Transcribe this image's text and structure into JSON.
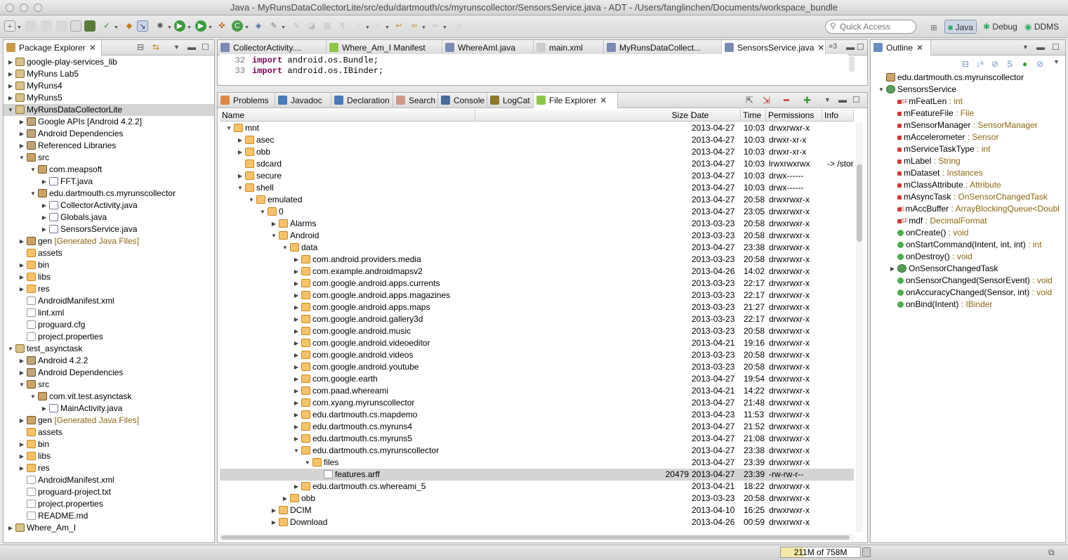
{
  "window": {
    "title": "Java - MyRunsDataCollectorLite/src/edu/dartmouth/cs/myrunscollector/SensorsService.java - ADT - /Users/fanglinchen/Documents/workspace_bundle"
  },
  "toolbar": {
    "quick_access_placeholder": "Quick Access",
    "perspectives": [
      "Java",
      "Debug",
      "DDMS"
    ]
  },
  "package_explorer": {
    "tab_label": "Package Explorer",
    "items": [
      {
        "label": "google-play-services_lib",
        "suffix": "",
        "depth": 0,
        "icon": "proj",
        "twist": "closed"
      },
      {
        "label": "MyRuns Lab5",
        "suffix": "",
        "depth": 0,
        "icon": "proj",
        "twist": "closed"
      },
      {
        "label": "MyRuns4",
        "suffix": "",
        "depth": 0,
        "icon": "proj",
        "twist": "closed"
      },
      {
        "label": "MyRuns5",
        "suffix": "",
        "depth": 0,
        "icon": "proj",
        "twist": "closed"
      },
      {
        "label": "MyRunsDataCollectorLite",
        "suffix": "",
        "depth": 0,
        "icon": "proj",
        "twist": "open",
        "selected": true
      },
      {
        "label": "Google APIs [Android 4.2.2]",
        "suffix": "",
        "depth": 1,
        "icon": "lib",
        "twist": "closed"
      },
      {
        "label": "Android Dependencies",
        "suffix": "",
        "depth": 1,
        "icon": "lib",
        "twist": "closed"
      },
      {
        "label": "Referenced Libraries",
        "suffix": "",
        "depth": 1,
        "icon": "lib",
        "twist": "closed"
      },
      {
        "label": "src",
        "suffix": "",
        "depth": 1,
        "icon": "pkg",
        "twist": "open"
      },
      {
        "label": "com.meapsoft",
        "suffix": "",
        "depth": 2,
        "icon": "pkg",
        "twist": "open"
      },
      {
        "label": "FFT.java",
        "suffix": "",
        "depth": 3,
        "icon": "java",
        "twist": "closed"
      },
      {
        "label": "edu.dartmouth.cs.myrunscollector",
        "suffix": "",
        "depth": 2,
        "icon": "pkg",
        "twist": "open"
      },
      {
        "label": "CollectorActivity.java",
        "suffix": "",
        "depth": 3,
        "icon": "java",
        "twist": "closed"
      },
      {
        "label": "Globals.java",
        "suffix": "",
        "depth": 3,
        "icon": "java",
        "twist": "closed"
      },
      {
        "label": "SensorsService.java",
        "suffix": "",
        "depth": 3,
        "icon": "java",
        "twist": "closed"
      },
      {
        "label": "gen",
        "suffix": " [Generated Java Files]",
        "depth": 1,
        "icon": "pkg",
        "twist": "closed"
      },
      {
        "label": "assets",
        "suffix": "",
        "depth": 1,
        "icon": "folder",
        "twist": "none"
      },
      {
        "label": "bin",
        "suffix": "",
        "depth": 1,
        "icon": "folder",
        "twist": "closed"
      },
      {
        "label": "libs",
        "suffix": "",
        "depth": 1,
        "icon": "folder",
        "twist": "closed"
      },
      {
        "label": "res",
        "suffix": "",
        "depth": 1,
        "icon": "folder",
        "twist": "closed"
      },
      {
        "label": "AndroidManifest.xml",
        "suffix": "",
        "depth": 1,
        "icon": "file",
        "twist": "none"
      },
      {
        "label": "lint.xml",
        "suffix": "",
        "depth": 1,
        "icon": "file",
        "twist": "none"
      },
      {
        "label": "proguard.cfg",
        "suffix": "",
        "depth": 1,
        "icon": "file",
        "twist": "none"
      },
      {
        "label": "project.properties",
        "suffix": "",
        "depth": 1,
        "icon": "file",
        "twist": "none"
      },
      {
        "label": "test_asynctask",
        "suffix": "",
        "depth": 0,
        "icon": "proj",
        "twist": "open"
      },
      {
        "label": "Android 4.2.2",
        "suffix": "",
        "depth": 1,
        "icon": "lib",
        "twist": "closed"
      },
      {
        "label": "Android Dependencies",
        "suffix": "",
        "depth": 1,
        "icon": "lib",
        "twist": "closed"
      },
      {
        "label": "src",
        "suffix": "",
        "depth": 1,
        "icon": "pkg",
        "twist": "open"
      },
      {
        "label": "com.vit.test.asynctask",
        "suffix": "",
        "depth": 2,
        "icon": "pkg",
        "twist": "open"
      },
      {
        "label": "MainActivity.java",
        "suffix": "",
        "depth": 3,
        "icon": "java",
        "twist": "closed"
      },
      {
        "label": "gen",
        "suffix": " [Generated Java Files]",
        "depth": 1,
        "icon": "pkg",
        "twist": "closed"
      },
      {
        "label": "assets",
        "suffix": "",
        "depth": 1,
        "icon": "folder",
        "twist": "none"
      },
      {
        "label": "bin",
        "suffix": "",
        "depth": 1,
        "icon": "folder",
        "twist": "closed"
      },
      {
        "label": "libs",
        "suffix": "",
        "depth": 1,
        "icon": "folder",
        "twist": "closed"
      },
      {
        "label": "res",
        "suffix": "",
        "depth": 1,
        "icon": "folder",
        "twist": "closed"
      },
      {
        "label": "AndroidManifest.xml",
        "suffix": "",
        "depth": 1,
        "icon": "file",
        "twist": "none"
      },
      {
        "label": "proguard-project.txt",
        "suffix": "",
        "depth": 1,
        "icon": "file",
        "twist": "none"
      },
      {
        "label": "project.properties",
        "suffix": "",
        "depth": 1,
        "icon": "file",
        "twist": "none"
      },
      {
        "label": "README.md",
        "suffix": "",
        "depth": 1,
        "icon": "file",
        "twist": "none"
      },
      {
        "label": "Where_Am_I",
        "suffix": "",
        "depth": 0,
        "icon": "proj",
        "twist": "closed"
      }
    ]
  },
  "editor": {
    "tabs": [
      "CollectorActivity....",
      "Where_Am_I Manifest",
      "WhereAmI.java",
      "main.xml",
      "MyRunsDataCollect...",
      "SensorsService.java"
    ],
    "overflow": "»3",
    "lines": [
      {
        "num": "32",
        "kw": "import",
        "text": " android.os.Bundle;"
      },
      {
        "num": "33",
        "kw": "import",
        "text": " android.os.IBinder;"
      }
    ]
  },
  "bottom_tabs": [
    "Problems",
    "Javadoc",
    "Declaration",
    "Search",
    "Console",
    "LogCat",
    "File Explorer"
  ],
  "file_explorer": {
    "columns": [
      "Name",
      "Size",
      "Date",
      "Time",
      "Permissions",
      "Info"
    ],
    "rows": [
      {
        "name": "mnt",
        "depth": 0,
        "twist": "open",
        "size": "",
        "date": "2013-04-27",
        "time": "10:03",
        "perm": "drwxrwxr-x",
        "info": ""
      },
      {
        "name": "asec",
        "depth": 1,
        "twist": "closed",
        "size": "",
        "date": "2013-04-27",
        "time": "10:03",
        "perm": "drwxr-xr-x",
        "info": ""
      },
      {
        "name": "obb",
        "depth": 1,
        "twist": "closed",
        "size": "",
        "date": "2013-04-27",
        "time": "10:03",
        "perm": "drwxr-xr-x",
        "info": ""
      },
      {
        "name": "sdcard",
        "depth": 1,
        "twist": "none",
        "size": "",
        "date": "2013-04-27",
        "time": "10:03",
        "perm": "lrwxrwxrwx",
        "info": "-> /stora"
      },
      {
        "name": "secure",
        "depth": 1,
        "twist": "closed",
        "size": "",
        "date": "2013-04-27",
        "time": "10:03",
        "perm": "drwx------",
        "info": ""
      },
      {
        "name": "shell",
        "depth": 1,
        "twist": "open",
        "size": "",
        "date": "2013-04-27",
        "time": "10:03",
        "perm": "drwx------",
        "info": ""
      },
      {
        "name": "emulated",
        "depth": 2,
        "twist": "open",
        "size": "",
        "date": "2013-04-27",
        "time": "20:58",
        "perm": "drwxrwxr-x",
        "info": ""
      },
      {
        "name": "0",
        "depth": 3,
        "twist": "open",
        "size": "",
        "date": "2013-04-27",
        "time": "23:05",
        "perm": "drwxrwxr-x",
        "info": ""
      },
      {
        "name": "Alarms",
        "depth": 4,
        "twist": "closed",
        "size": "",
        "date": "2013-03-23",
        "time": "20:58",
        "perm": "drwxrwxr-x",
        "info": ""
      },
      {
        "name": "Android",
        "depth": 4,
        "twist": "open",
        "size": "",
        "date": "2013-03-23",
        "time": "20:58",
        "perm": "drwxrwxr-x",
        "info": ""
      },
      {
        "name": "data",
        "depth": 5,
        "twist": "open",
        "size": "",
        "date": "2013-04-27",
        "time": "23:38",
        "perm": "drwxrwxr-x",
        "info": ""
      },
      {
        "name": "com.android.providers.media",
        "depth": 6,
        "twist": "closed",
        "size": "",
        "date": "2013-03-23",
        "time": "20:58",
        "perm": "drwxrwxr-x",
        "info": ""
      },
      {
        "name": "com.example.androidmapsv2",
        "depth": 6,
        "twist": "closed",
        "size": "",
        "date": "2013-04-26",
        "time": "14:02",
        "perm": "drwxrwxr-x",
        "info": ""
      },
      {
        "name": "com.google.android.apps.currents",
        "depth": 6,
        "twist": "closed",
        "size": "",
        "date": "2013-03-23",
        "time": "22:17",
        "perm": "drwxrwxr-x",
        "info": ""
      },
      {
        "name": "com.google.android.apps.magazines",
        "depth": 6,
        "twist": "closed",
        "size": "",
        "date": "2013-03-23",
        "time": "22:17",
        "perm": "drwxrwxr-x",
        "info": ""
      },
      {
        "name": "com.google.android.apps.maps",
        "depth": 6,
        "twist": "closed",
        "size": "",
        "date": "2013-03-23",
        "time": "21:27",
        "perm": "drwxrwxr-x",
        "info": ""
      },
      {
        "name": "com.google.android.gallery3d",
        "depth": 6,
        "twist": "closed",
        "size": "",
        "date": "2013-03-23",
        "time": "22:17",
        "perm": "drwxrwxr-x",
        "info": ""
      },
      {
        "name": "com.google.android.music",
        "depth": 6,
        "twist": "closed",
        "size": "",
        "date": "2013-03-23",
        "time": "20:58",
        "perm": "drwxrwxr-x",
        "info": ""
      },
      {
        "name": "com.google.android.videoeditor",
        "depth": 6,
        "twist": "closed",
        "size": "",
        "date": "2013-04-21",
        "time": "19:16",
        "perm": "drwxrwxr-x",
        "info": ""
      },
      {
        "name": "com.google.android.videos",
        "depth": 6,
        "twist": "closed",
        "size": "",
        "date": "2013-03-23",
        "time": "20:58",
        "perm": "drwxrwxr-x",
        "info": ""
      },
      {
        "name": "com.google.android.youtube",
        "depth": 6,
        "twist": "closed",
        "size": "",
        "date": "2013-03-23",
        "time": "20:58",
        "perm": "drwxrwxr-x",
        "info": ""
      },
      {
        "name": "com.google.earth",
        "depth": 6,
        "twist": "closed",
        "size": "",
        "date": "2013-04-27",
        "time": "19:54",
        "perm": "drwxrwxr-x",
        "info": ""
      },
      {
        "name": "com.paad.whereami",
        "depth": 6,
        "twist": "closed",
        "size": "",
        "date": "2013-04-21",
        "time": "14:22",
        "perm": "drwxrwxr-x",
        "info": ""
      },
      {
        "name": "com.xyang.myrunscollector",
        "depth": 6,
        "twist": "closed",
        "size": "",
        "date": "2013-04-27",
        "time": "21:48",
        "perm": "drwxrwxr-x",
        "info": ""
      },
      {
        "name": "edu.dartmouth.cs.mapdemo",
        "depth": 6,
        "twist": "closed",
        "size": "",
        "date": "2013-04-23",
        "time": "11:53",
        "perm": "drwxrwxr-x",
        "info": ""
      },
      {
        "name": "edu.dartmouth.cs.myruns4",
        "depth": 6,
        "twist": "closed",
        "size": "",
        "date": "2013-04-27",
        "time": "21:52",
        "perm": "drwxrwxr-x",
        "info": ""
      },
      {
        "name": "edu.dartmouth.cs.myruns5",
        "depth": 6,
        "twist": "closed",
        "size": "",
        "date": "2013-04-27",
        "time": "21:08",
        "perm": "drwxrwxr-x",
        "info": ""
      },
      {
        "name": "edu.dartmouth.cs.myrunscollector",
        "depth": 6,
        "twist": "open",
        "size": "",
        "date": "2013-04-27",
        "time": "23:38",
        "perm": "drwxrwxr-x",
        "info": ""
      },
      {
        "name": "files",
        "depth": 7,
        "twist": "open",
        "size": "",
        "date": "2013-04-27",
        "time": "23:39",
        "perm": "drwxrwxr-x",
        "info": ""
      },
      {
        "name": "features.arff",
        "depth": 8,
        "twist": "none",
        "file": true,
        "selected": true,
        "size": "20479",
        "date": "2013-04-27",
        "time": "23:39",
        "perm": "-rw-rw-r--",
        "info": ""
      },
      {
        "name": "edu.dartmouth.cs.whereami_5",
        "depth": 6,
        "twist": "closed",
        "size": "",
        "date": "2013-04-21",
        "time": "18:22",
        "perm": "drwxrwxr-x",
        "info": ""
      },
      {
        "name": "obb",
        "depth": 5,
        "twist": "closed",
        "size": "",
        "date": "2013-03-23",
        "time": "20:58",
        "perm": "drwxrwxr-x",
        "info": ""
      },
      {
        "name": "DCIM",
        "depth": 4,
        "twist": "closed",
        "size": "",
        "date": "2013-04-10",
        "time": "16:25",
        "perm": "drwxrwxr-x",
        "info": ""
      },
      {
        "name": "Download",
        "depth": 4,
        "twist": "closed",
        "size": "",
        "date": "2013-04-26",
        "time": "00:59",
        "perm": "drwxrwxr-x",
        "info": ""
      }
    ]
  },
  "outline": {
    "tab_label": "Outline",
    "items": [
      {
        "label": "edu.dartmouth.cs.myrunscollector",
        "type": "",
        "depth": 0,
        "icon": "pkg",
        "twist": "none"
      },
      {
        "label": "SensorsService",
        "type": "",
        "depth": 0,
        "icon": "cls",
        "twist": "open"
      },
      {
        "label": "mFeatLen",
        "type": " : int",
        "depth": 1,
        "icon": "red",
        "mod": "SF",
        "twist": "none"
      },
      {
        "label": "mFeatureFile",
        "type": " : File",
        "depth": 1,
        "icon": "red",
        "mod": "",
        "twist": "none"
      },
      {
        "label": "mSensorManager",
        "type": " : SensorManager",
        "depth": 1,
        "icon": "red",
        "mod": "",
        "twist": "none"
      },
      {
        "label": "mAccelerometer",
        "type": " : Sensor",
        "depth": 1,
        "icon": "red",
        "mod": "",
        "twist": "none"
      },
      {
        "label": "mServiceTaskType",
        "type": " : int",
        "depth": 1,
        "icon": "red",
        "mod": "",
        "twist": "none"
      },
      {
        "label": "mLabel",
        "type": " : String",
        "depth": 1,
        "icon": "red",
        "mod": "",
        "twist": "none"
      },
      {
        "label": "mDataset",
        "type": " : Instances",
        "depth": 1,
        "icon": "red",
        "mod": "",
        "twist": "none"
      },
      {
        "label": "mClassAttribute",
        "type": " : Attribute",
        "depth": 1,
        "icon": "red",
        "mod": "",
        "twist": "none"
      },
      {
        "label": "mAsyncTask",
        "type": " : OnSensorChangedTask",
        "depth": 1,
        "icon": "red",
        "mod": "",
        "twist": "none"
      },
      {
        "label": "mAccBuffer",
        "type": " : ArrayBlockingQueue<Doubl",
        "depth": 1,
        "icon": "red",
        "mod": "S",
        "twist": "none"
      },
      {
        "label": "mdf",
        "type": " : DecimalFormat",
        "depth": 1,
        "icon": "red",
        "mod": "SF",
        "twist": "none"
      },
      {
        "label": "onCreate()",
        "type": " : void",
        "depth": 1,
        "icon": "green",
        "mod": "",
        "twist": "none"
      },
      {
        "label": "onStartCommand(Intent, int, int)",
        "type": " : int",
        "depth": 1,
        "icon": "green",
        "mod": "",
        "twist": "none"
      },
      {
        "label": "onDestroy()",
        "type": " : void",
        "depth": 1,
        "icon": "green",
        "mod": "",
        "twist": "none"
      },
      {
        "label": "OnSensorChangedTask",
        "type": "",
        "depth": 1,
        "icon": "cls",
        "mod": "",
        "twist": "closed"
      },
      {
        "label": "onSensorChanged(SensorEvent)",
        "type": " : void",
        "depth": 1,
        "icon": "green",
        "mod": "",
        "twist": "none"
      },
      {
        "label": "onAccuracyChanged(Sensor, int)",
        "type": " : void",
        "depth": 1,
        "icon": "green",
        "mod": "",
        "twist": "none"
      },
      {
        "label": "onBind(Intent)",
        "type": " : IBinder",
        "depth": 1,
        "icon": "green",
        "mod": "",
        "twist": "none"
      }
    ]
  },
  "status": {
    "heap": "211M of 758M",
    "heap_used_fraction": 0.28
  }
}
